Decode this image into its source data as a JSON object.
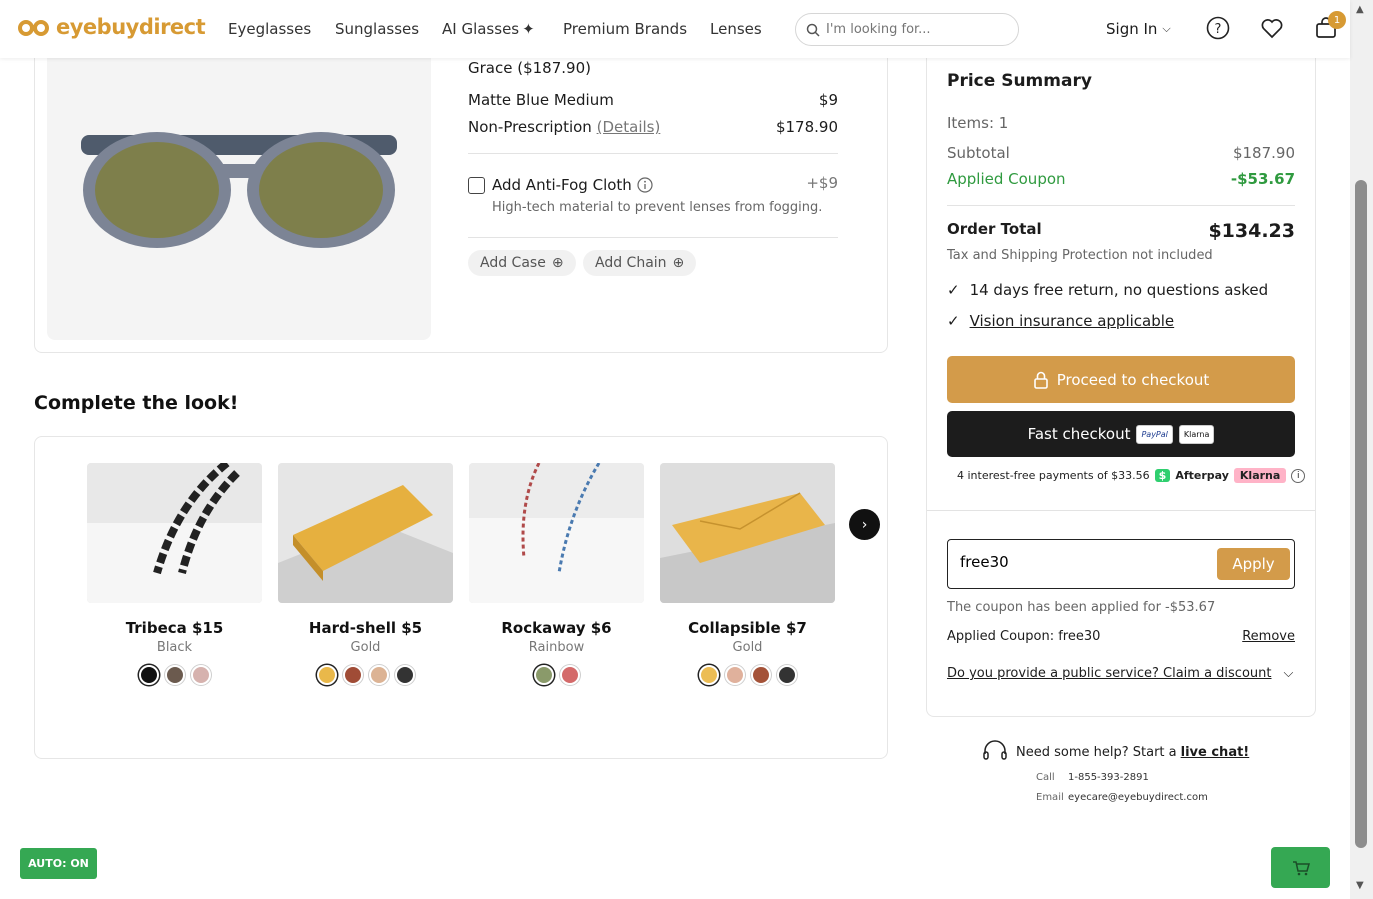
{
  "header": {
    "brand": "eyebuydirect",
    "nav": [
      "Eyeglasses",
      "Sunglasses",
      "AI Glasses",
      "Premium Brands",
      "Lenses"
    ],
    "search_placeholder": "I'm looking for...",
    "sign_in": "Sign In",
    "cart_count": "1"
  },
  "product": {
    "name": "Grace ($187.90)",
    "lines": [
      {
        "label": "Matte Blue Medium",
        "value": "$9"
      },
      {
        "label": "Non-Prescription",
        "link": "(Details)",
        "value": "$178.90"
      }
    ],
    "addon": {
      "label": "Add Anti-Fog Cloth",
      "price": "+$9",
      "desc": "High-tech material to prevent lenses from fogging."
    },
    "pills": [
      "Add Case",
      "Add Chain"
    ]
  },
  "complete_look": {
    "title": "Complete the look!",
    "items": [
      {
        "name": "Tribeca $15",
        "color": "Black",
        "swatches": [
          "#111111",
          "#6b5a4e",
          "#d6b2ae"
        ]
      },
      {
        "name": "Hard-shell $5",
        "color": "Gold",
        "swatches": [
          "#e9b84a",
          "#a04c36",
          "#dcb394",
          "#333333"
        ]
      },
      {
        "name": "Rockaway $6",
        "color": "Rainbow",
        "swatches": [
          "#8a9a6a",
          "#d46a6a"
        ]
      },
      {
        "name": "Collapsible $7",
        "color": "Gold",
        "swatches": [
          "#ecbd55",
          "#e0b19c",
          "#a45238",
          "#333333"
        ]
      }
    ]
  },
  "summary": {
    "title": "Price Summary",
    "items": "Items: 1",
    "subtotal_label": "Subtotal",
    "subtotal": "$187.90",
    "coupon_label": "Applied Coupon",
    "coupon_value": "-$53.67",
    "total_label": "Order Total",
    "total": "$134.23",
    "tax_note": "Tax and Shipping Protection not included",
    "perks": [
      "14 days free return, no questions asked",
      "Vision insurance applicable"
    ],
    "checkout": "Proceed to checkout",
    "fast": "Fast checkout",
    "paypal": "PayPal",
    "klarna": "Klarna",
    "installments": "4 interest-free payments of $33.56",
    "afterpay": "Afterpay",
    "coupon_input": "free30",
    "apply": "Apply",
    "coupon_msg": "The coupon has been applied for -$53.67",
    "applied_coupon": "Applied Coupon: free30",
    "remove": "Remove",
    "public_service": "Do you provide a public service? Claim a discount"
  },
  "help": {
    "text": "Need some help? Start a",
    "link": "live chat!",
    "call_label": "Call",
    "phone": "1-855-393-2891",
    "email_label": "Email",
    "email": "eyecare@eyebuydirect.com"
  },
  "auto": "AUTO: ON",
  "colors": {
    "accent": "#d39b4a",
    "green": "#2f9a3f",
    "extension": "#35a853"
  }
}
